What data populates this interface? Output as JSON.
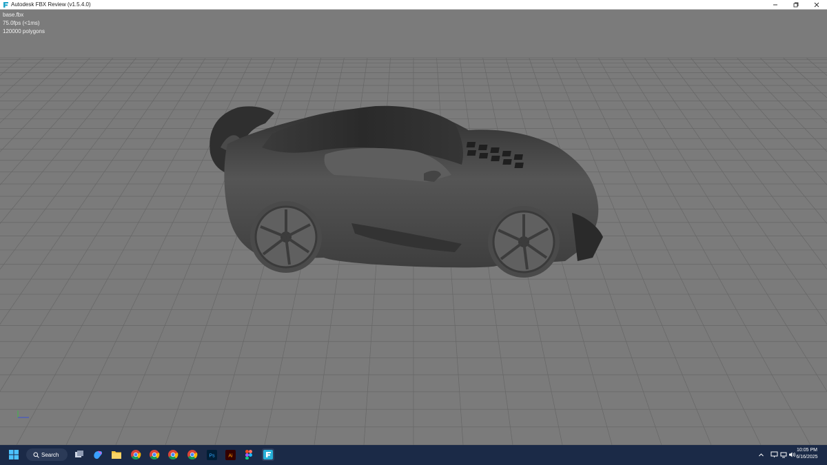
{
  "window": {
    "title": "Autodesk FBX Review (v1.5.4.0)",
    "icon": "fbx-app-icon",
    "controls": [
      "minimize",
      "restore",
      "close"
    ]
  },
  "viewport": {
    "file_name": "base.fbx",
    "fps": "75.0fps (<1ms)",
    "polygons": "120000 polygons",
    "background_color": "#7b7b7b",
    "grid_color": "#666666"
  },
  "taskbar": {
    "search_label": "Search",
    "apps": [
      "windows-start-icon",
      "task-view-icon",
      "copilot-icon",
      "file-explorer-icon",
      "chrome-icon",
      "chrome-icon",
      "chrome-icon",
      "chrome-icon",
      "photoshop-icon",
      "illustrator-icon",
      "figma-icon",
      "fbx-review-icon"
    ],
    "time": "10:05 PM",
    "date": "6/16/2025",
    "accent_color": "#1b2a47"
  }
}
